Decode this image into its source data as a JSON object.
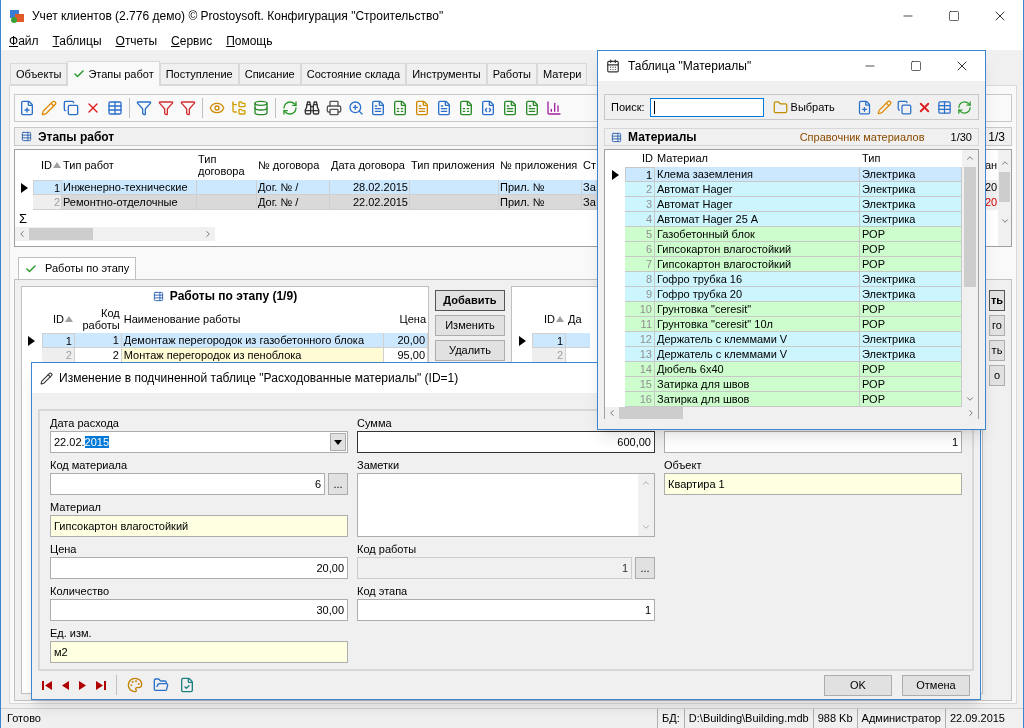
{
  "window": {
    "title": "Учет клиентов (2.776 демо) © Prostoysoft. Конфигурация \"Строительство\""
  },
  "menu": [
    {
      "label": "Файл"
    },
    {
      "label": "Таблицы"
    },
    {
      "label": "Отчеты"
    },
    {
      "label": "Сервис"
    },
    {
      "label": "Помощь"
    }
  ],
  "tabs": [
    {
      "label": "Объекты",
      "selected": false
    },
    {
      "label": "Этапы работ",
      "selected": true
    },
    {
      "label": "Поступление",
      "selected": false
    },
    {
      "label": "Списание",
      "selected": false
    },
    {
      "label": "Состояние склада",
      "selected": false
    },
    {
      "label": "Инструменты",
      "selected": false
    },
    {
      "label": "Работы",
      "selected": false
    },
    {
      "label": "Матери",
      "selected": false
    }
  ],
  "stages_panel": {
    "title": "Этапы работ",
    "counter": "1/3",
    "columns": [
      {
        "label": "ID",
        "sorted": true
      },
      {
        "label": "Тип работ",
        "sorted": false
      },
      {
        "label": "Тип договора",
        "sorted": false
      },
      {
        "label": "№ договора",
        "sorted": false
      },
      {
        "label": "Дата договора",
        "sorted": false
      },
      {
        "label": "Тип приложения",
        "sorted": false
      },
      {
        "label": "№ приложения",
        "sorted": false
      },
      {
        "label": "Ст"
      }
    ],
    "rows": [
      {
        "selected": true,
        "color": "#cce8ff",
        "cells": [
          "1",
          "Инженерно-технические",
          null,
          "Дог. № /",
          "28.02.2015",
          null,
          "Прил. №",
          "За"
        ]
      },
      {
        "selected": false,
        "color": "#d9d9d9",
        "cells": [
          "2",
          "Ремонтно-отделочные",
          null,
          "Дог. № /",
          "22.02.2015",
          null,
          "Прил. №",
          "За"
        ]
      }
    ],
    "totals_symbol": "Σ",
    "edge_column": {
      "label": "ан",
      "cells": [
        {
          "text": "20",
          "alert": false
        },
        {
          "text": "20",
          "alert": true
        }
      ]
    }
  },
  "sub_tab": {
    "label": "Работы по этапу",
    "selected": true
  },
  "works_panel": {
    "title": "Работы по этапу (1/9)",
    "columns": [
      {
        "label": "ID",
        "sorted": true
      },
      {
        "label": "Код работы",
        "sorted": false
      },
      {
        "label": "Наименование работы",
        "sorted": false
      },
      {
        "label": "Цена",
        "sorted": false
      }
    ],
    "rows": [
      {
        "selected": true,
        "color": "#cce8ff",
        "cells": [
          "1",
          "1",
          "Демонтаж перегородок из газобетонного блока",
          "20,00"
        ]
      },
      {
        "selected": false,
        "color": "#fffbd5",
        "cells": [
          "2",
          "2",
          "Монтаж перегородок из пеноблока",
          "95,00"
        ]
      }
    ]
  },
  "works_buttons": [
    {
      "label": "Добавить",
      "default": true
    },
    {
      "label": "Изменить",
      "default": false
    },
    {
      "label": "Удалить",
      "default": false
    }
  ],
  "used_panel": {
    "columns": [
      {
        "label": "ID",
        "sorted": true
      },
      {
        "label": "Да",
        "sorted": false
      }
    ],
    "rows": [
      {
        "selected": true,
        "cells": [
          "1"
        ]
      },
      {
        "selected": false,
        "cells": [
          "2"
        ]
      }
    ]
  },
  "used_buttons": [
    {
      "label": "ть",
      "default": true
    },
    {
      "label": "го",
      "default": false
    },
    {
      "label": "ть",
      "default": false
    },
    {
      "label": "о",
      "default": false
    }
  ],
  "edit_dialog": {
    "title": "Изменение в подчиненной таблице \"Расходованные материалы\" (ID=1)",
    "columns": [
      [
        {
          "kind": "date",
          "label": "Дата расхода",
          "value": "22.02.",
          "selection": "2015",
          "readonly": false,
          "disabled": false,
          "focused": false
        },
        {
          "kind": "lookup",
          "label": "Код материала",
          "value": "6",
          "button": "...",
          "numeric": true,
          "readonly": false,
          "disabled": false,
          "focused": false
        },
        {
          "kind": "text",
          "label": "Материал",
          "value": "Гипсокартон влагостойкий",
          "numeric": false,
          "readonly": true,
          "disabled": false,
          "focused": false
        },
        {
          "kind": "text",
          "label": "Цена",
          "value": "20,00",
          "numeric": true,
          "readonly": false,
          "disabled": false,
          "focused": false
        },
        {
          "kind": "text",
          "label": "Количество",
          "value": "30,00",
          "numeric": true,
          "readonly": false,
          "disabled": false,
          "focused": false
        },
        {
          "kind": "text",
          "label": "Ед. изм.",
          "value": "м2",
          "numeric": false,
          "readonly": true,
          "disabled": false,
          "focused": false
        }
      ],
      [
        {
          "kind": "text",
          "label": "Сумма",
          "value": "600,00",
          "numeric": true,
          "readonly": false,
          "disabled": false,
          "focused": true
        },
        {
          "kind": "memo",
          "label": "Заметки",
          "readonly": false,
          "disabled": false,
          "focused": false
        },
        {
          "kind": "lookup",
          "label": "Код работы",
          "value": "1",
          "button": "...",
          "numeric": true,
          "disabled": true,
          "focused": false
        },
        {
          "kind": "text",
          "label": "Код этапа",
          "value": "1",
          "numeric": true,
          "readonly": false,
          "disabled": false,
          "focused": false
        }
      ],
      [
        {
          "kind": "text",
          "value": "1",
          "numeric": true,
          "readonly": false,
          "disabled": false,
          "focused": false
        },
        {
          "kind": "text",
          "label": "Объект",
          "value": "Квартира 1",
          "numeric": false,
          "readonly": true,
          "disabled": false,
          "focused": false
        }
      ]
    ],
    "buttons": [
      {
        "label": "OK"
      },
      {
        "label": "Отмена"
      }
    ]
  },
  "materials_window": {
    "title": "Таблица \"Материалы\"",
    "search_label": "Поиск:",
    "select_button": "Выбрать",
    "header": {
      "title": "Материалы",
      "subtitle": "Справочник материалов",
      "counter": "1/30"
    },
    "columns": [
      {
        "label": "ID"
      },
      {
        "label": "Материал"
      },
      {
        "label": "Тип"
      }
    ],
    "rows": [
      {
        "cells": [
          "1",
          "Клема заземления",
          "Электрика"
        ],
        "selected": true
      },
      {
        "cells": [
          "2",
          "Автомат Hager",
          "Электрика"
        ],
        "color": "#ccf5fd",
        "selected": false
      },
      {
        "cells": [
          "3",
          "Автомат Hager",
          "Электрика"
        ],
        "color": "#ccf5fd",
        "selected": false
      },
      {
        "cells": [
          "4",
          "Автомат Hager 25 А",
          "Электрика"
        ],
        "color": "#ccf5fd",
        "selected": false
      },
      {
        "cells": [
          "5",
          "Газобетонный блок",
          "РОР"
        ],
        "color": "#cdfccd",
        "selected": false
      },
      {
        "cells": [
          "6",
          "Гипсокартон влагостойкий",
          "РОР"
        ],
        "color": "#cdfccd",
        "selected": false
      },
      {
        "cells": [
          "7",
          "Гипсокартон влагостойкий",
          "РОР"
        ],
        "color": "#cdfccd",
        "selected": false
      },
      {
        "cells": [
          "8",
          "Гофро трубка 16",
          "Электрика"
        ],
        "color": "#ccf5fd",
        "selected": false
      },
      {
        "cells": [
          "9",
          "Гофро трубка 20",
          "Электрика"
        ],
        "color": "#ccf5fd",
        "selected": false
      },
      {
        "cells": [
          "10",
          "Грунтовка \"ceresit\"",
          "РОР"
        ],
        "color": "#cdfccd",
        "selected": false
      },
      {
        "cells": [
          "11",
          "Грунтовка \"ceresit\"  10л",
          "РОР"
        ],
        "color": "#cdfccd",
        "selected": false
      },
      {
        "cells": [
          "12",
          "Держатель с клеммами V",
          "Электрика"
        ],
        "color": "#ccf5fd",
        "selected": false
      },
      {
        "cells": [
          "13",
          "Держатель с клеммами V",
          "Электрика"
        ],
        "color": "#ccf5fd",
        "selected": false
      },
      {
        "cells": [
          "14",
          "Дюбель 6х40",
          "РОР"
        ],
        "color": "#cdfccd",
        "selected": false
      },
      {
        "cells": [
          "15",
          "Затирка для швов",
          "РОР"
        ],
        "color": "#cdfccd",
        "selected": false
      },
      {
        "cells": [
          "16",
          "Затирка для швов",
          "РОР"
        ],
        "color": "#cdfccd",
        "selected": false
      }
    ]
  },
  "status_bar": {
    "message": "Готово",
    "cells": [
      "БД:",
      "D:\\Building\\Building.mdb",
      "988 Kb",
      "Администратор",
      "22.09.2015"
    ]
  }
}
